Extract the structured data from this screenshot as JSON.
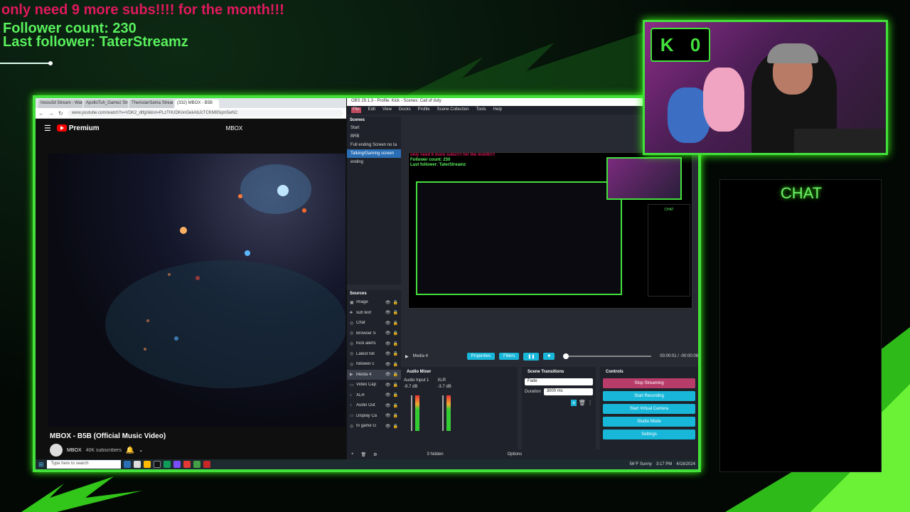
{
  "overlay": {
    "goal_text": "only need 9 more subs!!!! for the month!!!",
    "follower_count": "Follower count: 230",
    "last_follower": "Last follower: TaterStreamz"
  },
  "browser": {
    "tabs": [
      "Inoou3d Stream - Watch Li",
      "ApolloTuh_Gamez Stream",
      "TheAsianSama Stream",
      "(332) MBOX - B5B"
    ],
    "url": "www.youtube.com/watch?v=VDK2_dtfg0&list=PLzTHUDKnnGekAbJcTCKM8Sqm5wN2",
    "youtube": {
      "logo": "Premium",
      "channel_top": "MBOX",
      "video_title": "MBOX - B5B (Official Music Video)",
      "channel": "MBOX",
      "subscribers": "40K subscribers"
    }
  },
  "obs": {
    "title": "OBS 29.1.3 - Profile: Kick - Scenes: Call of duty",
    "menu": [
      "File",
      "Edit",
      "View",
      "Docks",
      "Profile",
      "Scene Collection",
      "Tools",
      "Help"
    ],
    "scenes_header": "Scenes",
    "scenes": [
      "Start",
      "BRB",
      "Full ending Screen no ta",
      "Talking/Gaming screen",
      "ending"
    ],
    "sources_header": "Sources",
    "sources": [
      "Image",
      "sub text",
      "Chat",
      "Browser S",
      "Kick alerts",
      "Latest foll",
      "follower c",
      "Media 4",
      "Video Cap",
      "XLR",
      "Audio Out",
      "Display Ca",
      "In game G"
    ],
    "preview_chat": "CHAT",
    "media_name": "Media 4",
    "properties": "Properties",
    "filters": "Filters",
    "timecode": "00:00:01 / -00:00:08",
    "mixer_header": "Audio Mixer",
    "mixer_ch1": "Audio Input 1",
    "mixer_ch2": "XLR",
    "mixer_db1": "-9.7 dB",
    "mixer_db2": "-3.7 dB",
    "transitions_header": "Scene Transitions",
    "transition": "Fade",
    "duration_label": "Duration",
    "duration": "3000 ms",
    "controls_header": "Controls",
    "controls": [
      "Stop Streaming",
      "Start Recording",
      "Start Virtual Camera",
      "Studio Mode",
      "Settings"
    ],
    "hidden": "3 hidden",
    "options": "Options"
  },
  "taskbar": {
    "search": "Type here to search",
    "weather": "56°F Sunny",
    "time": "3:17 PM",
    "date": "4/18/2024"
  },
  "cam": {
    "badge": [
      "K",
      "0"
    ]
  },
  "chat": {
    "title": "CHAT"
  },
  "colors": {
    "neon_green": "#43e03c",
    "goal_pink": "#e0195e",
    "obs_blue": "#18b7d9",
    "stop_red": "#b83c6a"
  }
}
